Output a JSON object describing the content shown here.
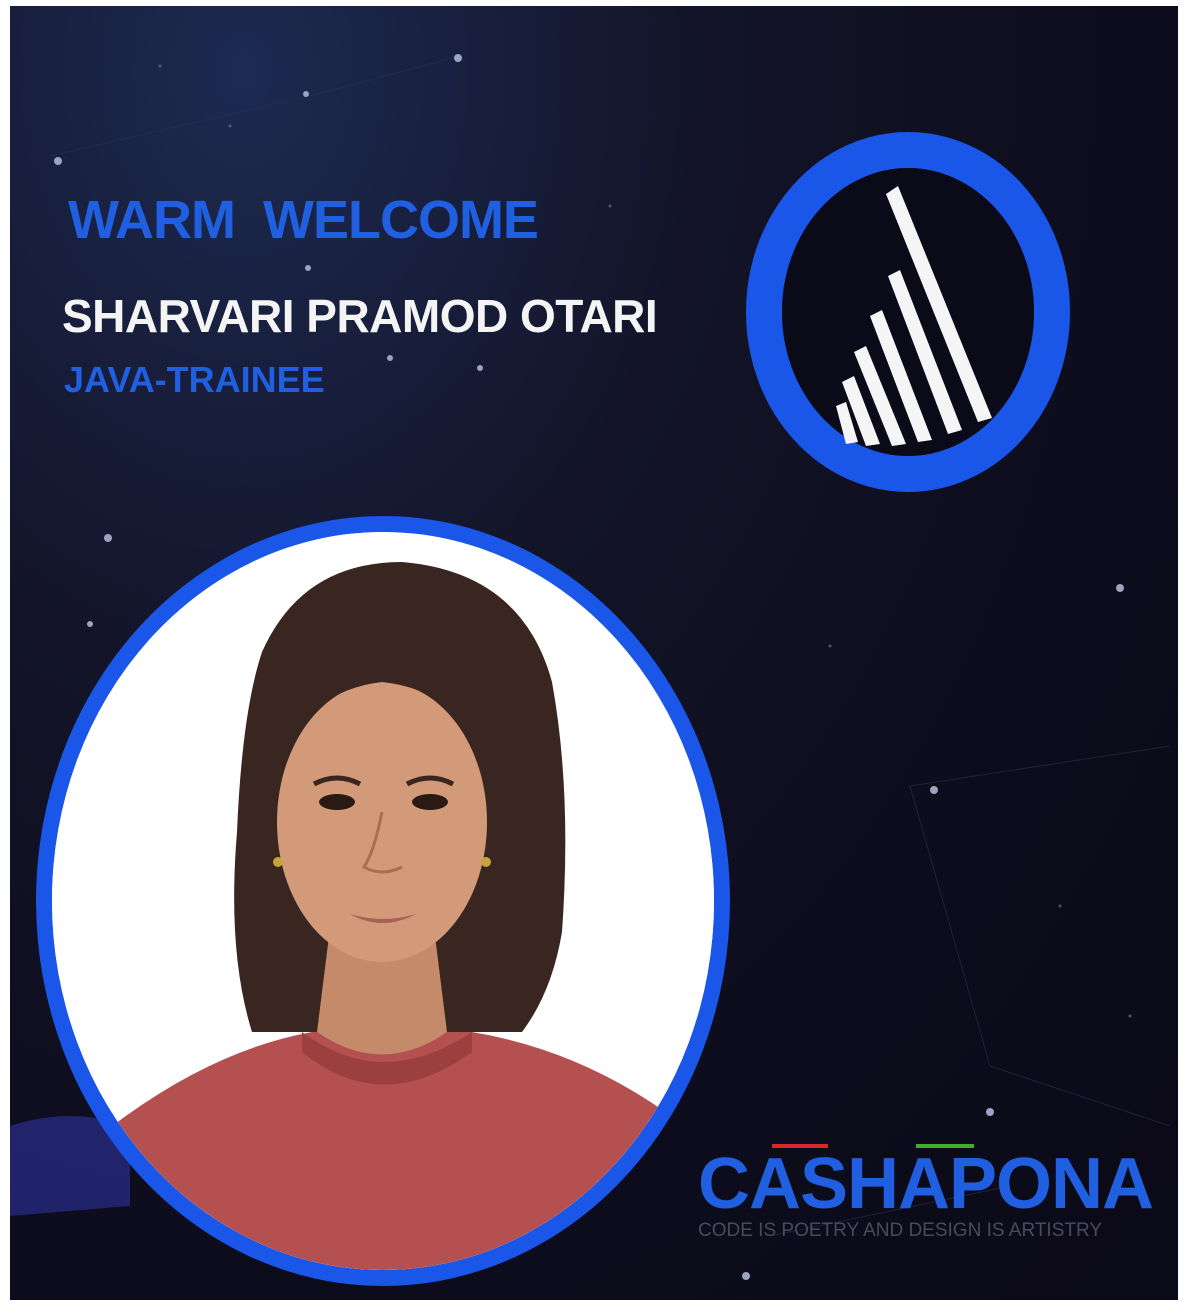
{
  "post": {
    "headline": "WARM  WELCOME",
    "person_name": "SHARVARI PRAMOD OTARI",
    "role": "JAVA-TRAINEE"
  },
  "brand": {
    "name": "CASHAPONA",
    "tagline": "CODE IS POETRY AND DESIGN IS ARTISTRY"
  },
  "icons": {
    "logo": "stacked-stripes-triangle-in-ring-icon",
    "photo": "person-portrait"
  },
  "colors": {
    "background": "#0d0c1c",
    "accent_blue": "#1f5fe0",
    "name_text": "#f4f4f4",
    "brand_red": "#d8262c",
    "brand_green": "#3fae2a"
  }
}
